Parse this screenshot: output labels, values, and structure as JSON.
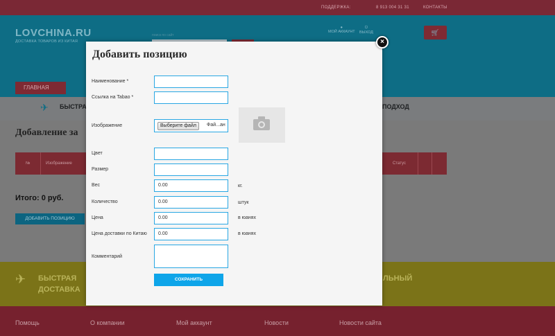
{
  "topbar": {
    "support": "ПОДДЕРЖКА:",
    "phone": "8 913 004 31 31",
    "contacts": "КОНТАКТЫ"
  },
  "header": {
    "logo": "LOVCHINA.RU",
    "logo_sub": "ДОСТАВКА ТОВАРОВ ИЗ КИТАЯ",
    "search_label": "поиск по сайт",
    "account": "МОЙ АККАУНТ",
    "logout": "ВЫХОД"
  },
  "nav": {
    "main": "ГЛАВНАЯ"
  },
  "features": {
    "fast": "БЫСТРАЯ",
    "approach": "ПОДХОД"
  },
  "page": {
    "title": "Добавление за",
    "columns": [
      "№",
      "Изображение",
      "Статус"
    ],
    "total": "Итого: 0 руб.",
    "add_button": "ДОБАВИТЬ ПОЗИЦИЮ"
  },
  "banner": {
    "fast_line1": "БЫСТРАЯ",
    "fast_line2": "ДОСТАВКА",
    "right_text": "ЛЬНЫЙ"
  },
  "footer": {
    "links": [
      "Помощь",
      "О компании",
      "Мой аккаунт",
      "Новости",
      "Новости сайта"
    ]
  },
  "modal": {
    "title": "Добавить позицию",
    "close_label": "×",
    "fields": {
      "name_label": "Наименование *",
      "link_label": "Ссылка на Tabao *",
      "image_label": "Изображение",
      "file_button": "Выберите файл",
      "file_text": "Фай...ан",
      "color_label": "Цвет",
      "size_label": "Размер",
      "weight_label": "Вес",
      "weight_value": "0.00",
      "weight_unit": "кг.",
      "qty_label": "Количество",
      "qty_value": "0.00",
      "qty_unit": "штук",
      "price_label": "Цена",
      "price_value": "0.00",
      "price_unit": "в юанях",
      "delivery_label": "Цена доставки по Китаю",
      "delivery_value": "0.00",
      "delivery_unit": "в юанях",
      "comment_label": "Комментарий"
    },
    "save_button": "СОХРАНИТЬ"
  }
}
